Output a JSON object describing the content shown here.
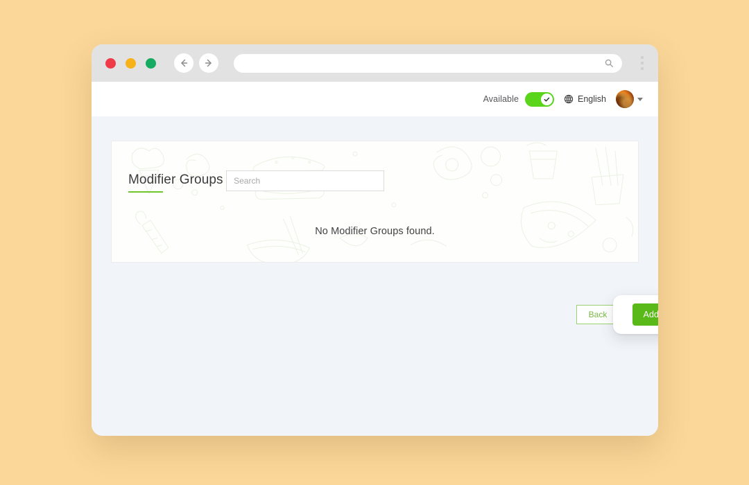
{
  "browser": {
    "traffic_lights": [
      "close",
      "minimize",
      "maximize"
    ],
    "back_icon": "arrow-left-icon",
    "forward_icon": "arrow-right-icon",
    "address_value": "",
    "address_placeholder": "",
    "address_search_icon": "search-icon",
    "menu_icon": "kebab-menu-icon"
  },
  "header": {
    "availability_label": "Available",
    "availability_on": true,
    "toggle_icon": "check-icon",
    "language_icon": "globe-icon",
    "language_label": "English",
    "avatar_icon": "user-avatar",
    "user_caret_icon": "chevron-down-icon"
  },
  "card": {
    "title": "Modifier Groups",
    "search_value": "",
    "search_placeholder": "Search",
    "empty_message": "No Modifier Groups found."
  },
  "actions": {
    "back_label": "Back",
    "add_label": "Add Modifier Group"
  },
  "colors": {
    "page_background": "#fbd79a",
    "accent_green": "#6ec62a",
    "button_green": "#58b918",
    "toggle_green": "#5ad51b",
    "app_background": "#f1f5f9",
    "card_background": "#fefefd"
  }
}
